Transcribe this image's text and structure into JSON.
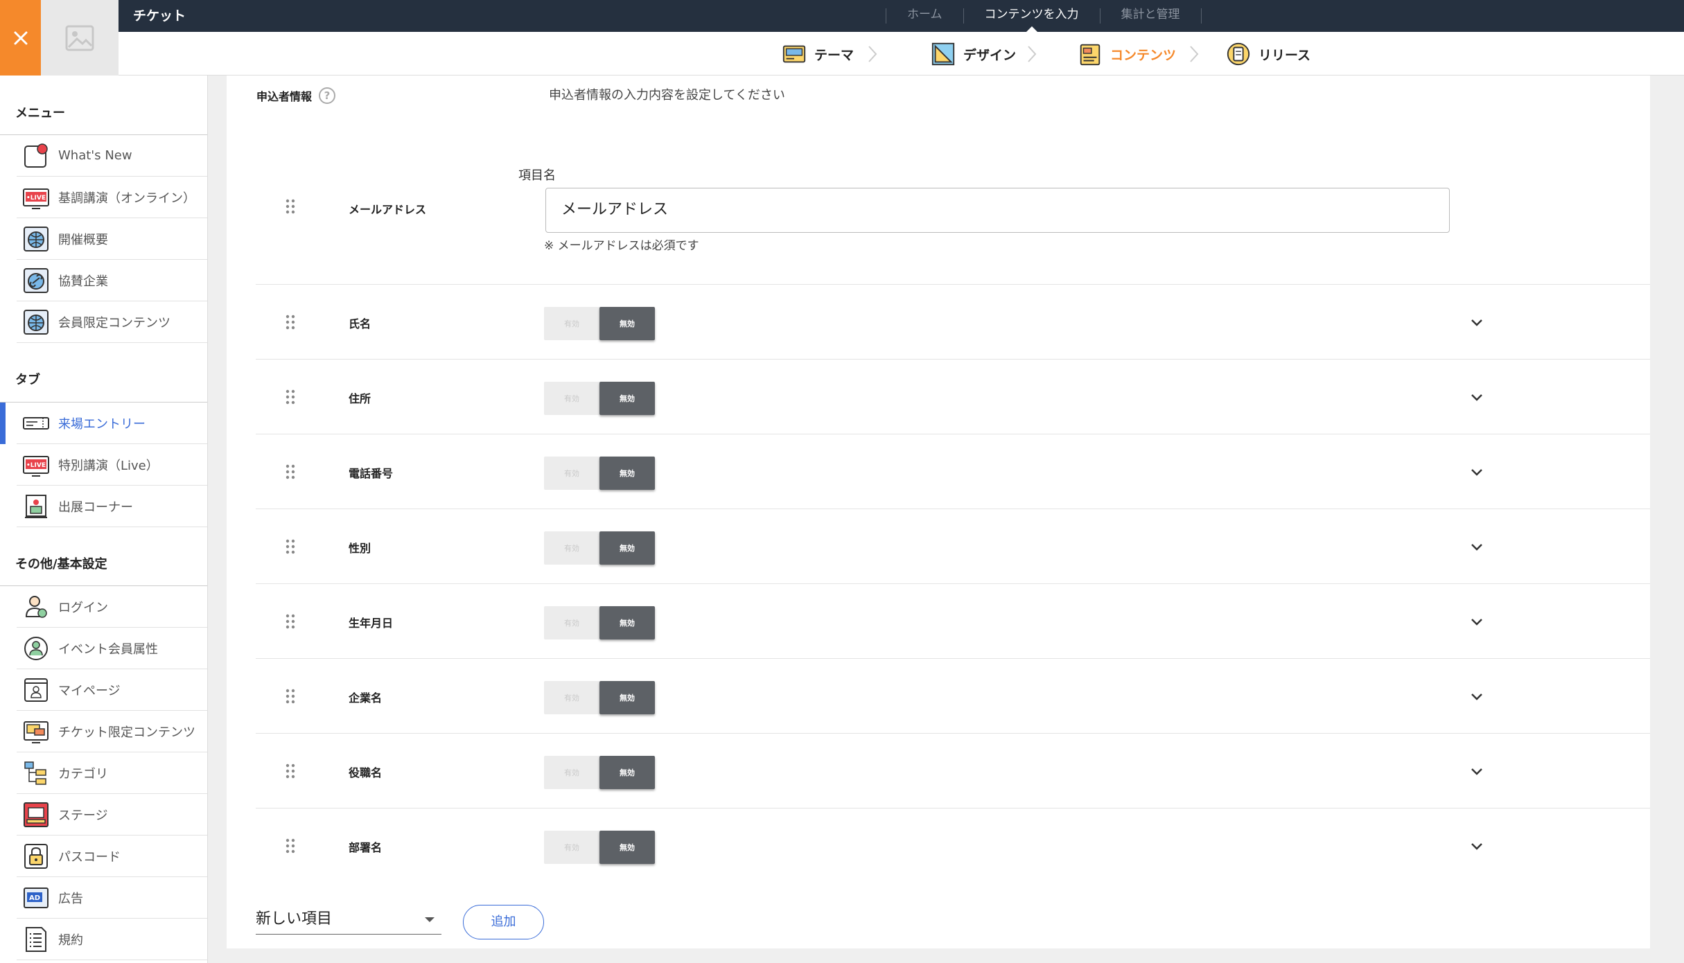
{
  "app": {
    "title": "チケット"
  },
  "topnav": [
    {
      "label": "ホーム",
      "active": false
    },
    {
      "label": "コンテンツを入力",
      "active": true
    },
    {
      "label": "集計と管理",
      "active": false
    }
  ],
  "steps": [
    {
      "label": "テーマ",
      "icon": "theme-icon",
      "active": false
    },
    {
      "label": "デザイン",
      "icon": "design-icon",
      "active": false
    },
    {
      "label": "コンテンツ",
      "icon": "contents-icon",
      "active": true
    },
    {
      "label": "リリース",
      "icon": "release-icon",
      "active": false
    }
  ],
  "sidebar": {
    "menu_title": "メニュー",
    "menu_items": [
      {
        "label": "What's New",
        "icon": "whats-new-icon"
      },
      {
        "label": "基調講演（オンライン）",
        "icon": "live-icon"
      },
      {
        "label": "開催概要",
        "icon": "globe-icon"
      },
      {
        "label": "協賛企業",
        "icon": "link-icon"
      },
      {
        "label": "会員限定コンテンツ",
        "icon": "globe-icon"
      }
    ],
    "tab_title": "タブ",
    "tab_items": [
      {
        "label": "来場エントリー",
        "icon": "ticket-icon",
        "active": true
      },
      {
        "label": "特別講演（Live）",
        "icon": "live-icon",
        "active": false
      },
      {
        "label": "出展コーナー",
        "icon": "booth-icon",
        "active": false
      }
    ],
    "other_title": "その他/基本設定",
    "other_items": [
      {
        "label": "ログイン",
        "icon": "login-icon"
      },
      {
        "label": "イベント会員属性",
        "icon": "member-icon"
      },
      {
        "label": "マイページ",
        "icon": "mypage-icon"
      },
      {
        "label": "チケット限定コンテンツ",
        "icon": "ticket-content-icon"
      },
      {
        "label": "カテゴリ",
        "icon": "category-icon"
      },
      {
        "label": "ステージ",
        "icon": "stage-icon"
      },
      {
        "label": "パスコード",
        "icon": "lock-icon"
      },
      {
        "label": "広告",
        "icon": "ad-icon"
      },
      {
        "label": "規約",
        "icon": "terms-icon"
      }
    ]
  },
  "main": {
    "section_label": "申込者情報",
    "section_desc": "申込者情報の入力内容を設定してください",
    "email_row": {
      "label": "メールアドレス",
      "field_caption": "項目名",
      "field_value": "メールアドレス",
      "note": "※ メールアドレスは必須です"
    },
    "rows": [
      {
        "label": "氏名",
        "on": "有効",
        "off": "無効"
      },
      {
        "label": "住所",
        "on": "有効",
        "off": "無効"
      },
      {
        "label": "電話番号",
        "on": "有効",
        "off": "無効"
      },
      {
        "label": "性別",
        "on": "有効",
        "off": "無効"
      },
      {
        "label": "生年月日",
        "on": "有効",
        "off": "無効"
      },
      {
        "label": "企業名",
        "on": "有効",
        "off": "無効"
      },
      {
        "label": "役職名",
        "on": "有効",
        "off": "無効"
      },
      {
        "label": "部署名",
        "on": "有効",
        "off": "無効"
      }
    ],
    "new_item_select": "新しい項目",
    "add_button": "追加"
  },
  "colors": {
    "accent": "#f5892b",
    "topbar": "#25303f",
    "link": "#3a6cd8",
    "toggle_off": "#5d6166"
  }
}
